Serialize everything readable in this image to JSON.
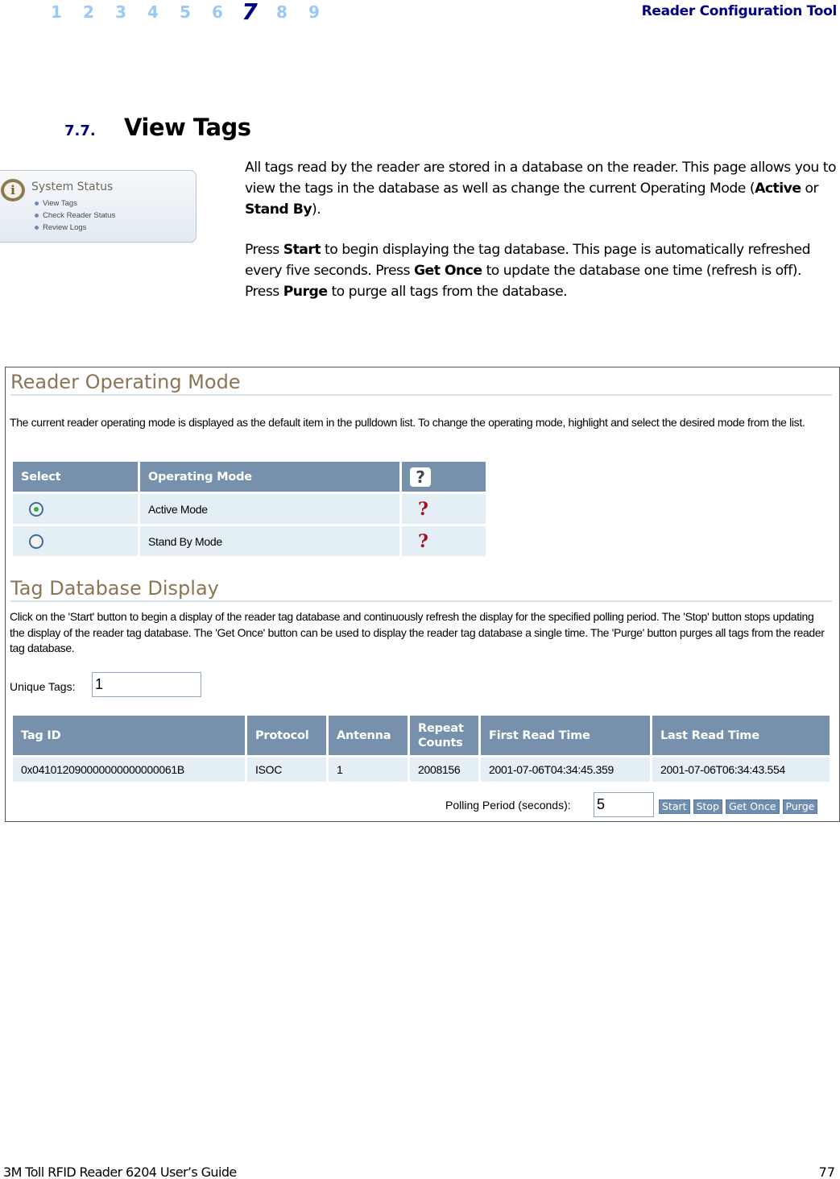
{
  "header": {
    "chapters": [
      "1",
      "2",
      "3",
      "4",
      "5",
      "6",
      "7",
      "8",
      "9"
    ],
    "active_chapter": "7",
    "running_title": "Reader Configuration Tool"
  },
  "section": {
    "number": "7.7.",
    "title": "View Tags"
  },
  "nav_thumbnail": {
    "icon": "info-icon",
    "icon_glyph": "i",
    "title": "System Status",
    "items": [
      "View Tags",
      "Check Reader Status",
      "Review Logs"
    ]
  },
  "intro": {
    "p1": {
      "t1": "All tags read by the reader are stored in a database on the reader. This page allows you to view the tags in the database as well as change the current Operating Mode (",
      "b1": "Active",
      "t2": " or ",
      "b2": "Stand By",
      "t3": ")."
    },
    "p2": {
      "t1": "Press ",
      "b1": "Start",
      "t2": " to begin displaying the tag database. This page is automatically refreshed every five seconds. Press ",
      "b2": "Get Once",
      "t3": " to update the database one time (refresh is off). Press ",
      "b3": "Purge",
      "t4": " to purge all tags from the database."
    }
  },
  "screenshot": {
    "operating_mode": {
      "heading": "Reader Operating Mode",
      "description": "The current reader operating mode is displayed as the default item in the pulldown list. To change the operating mode, highlight and select the desired mode from the list.",
      "columns": [
        "Select",
        "Operating Mode"
      ],
      "help_header_glyph": "?",
      "rows": [
        {
          "label": "Active Mode",
          "selected": true,
          "help_glyph": "?"
        },
        {
          "label": "Stand By Mode",
          "selected": false,
          "help_glyph": "?"
        }
      ]
    },
    "tag_database": {
      "heading": "Tag Database Display",
      "description": "Click on the 'Start' button to begin a display of the reader tag database and continuously refresh the display for the specified polling period. The 'Stop' button stops updating the display of the reader tag database. The 'Get Once' button can be used to display the reader tag database a single time. The 'Purge' button purges all tags from the reader tag database.",
      "unique_tags_label": "Unique Tags:",
      "unique_tags_value": "1",
      "columns": [
        "Tag ID",
        "Protocol",
        "Antenna",
        "Repeat Counts",
        "First Read Time",
        "Last Read Time"
      ],
      "rows": [
        [
          "0x041012090000000000000061B",
          "ISOC",
          "1",
          "2008156",
          "2001-07-06T04:34:45.359",
          "2001-07-06T06:34:43.554"
        ]
      ],
      "polling_label": "Polling Period (seconds):",
      "polling_value": "5",
      "buttons": {
        "start": "Start",
        "stop": "Stop",
        "get_once": "Get Once",
        "purge": "Purge"
      }
    }
  },
  "footer": {
    "guide_title": "3M Toll RFID Reader 6204 User’s Guide",
    "page_number": "77"
  }
}
